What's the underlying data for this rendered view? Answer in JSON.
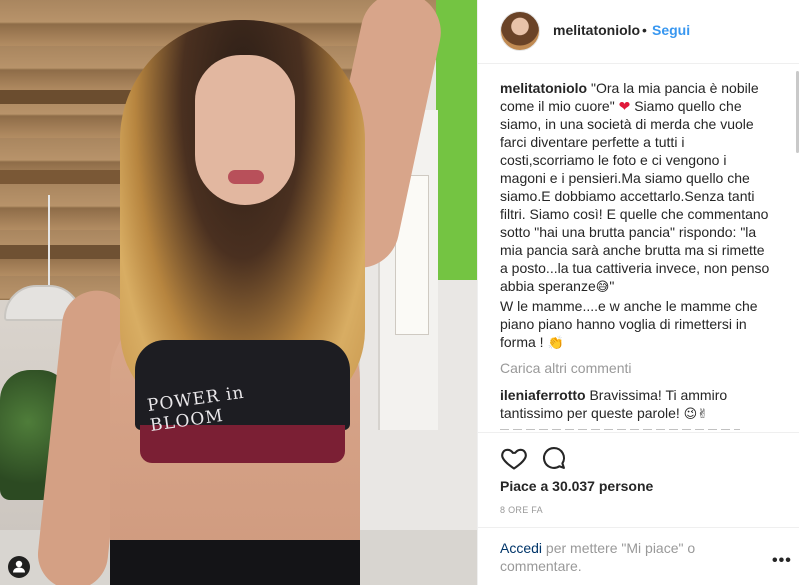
{
  "post": {
    "username": "melitatoniolo",
    "header_separator": "•",
    "follow_label": "Segui"
  },
  "caption": {
    "username": "melitatoniolo",
    "text_part1": "\"Ora la mia pancia è nobile come il mio cuore\"",
    "heart_emoji": "❤",
    "text_part2": "Siamo quello che siamo, in una società di merda che vuole farci diventare perfette a tutti i costi,scorriamo le foto e ci vengono i magoni e i pensieri.Ma siamo quello che siamo.E dobbiamo accettarlo.Senza tanti filtri. Siamo così! E quelle che commentano sotto \"hai una brutta pancia\" rispondo: \"la mia pancia sarà anche brutta ma si rimette a posto...la tua cattiveria invece, non penso abbia speranze",
    "emoji_2": "😅",
    "text_part3": "\"",
    "text_part4": "W le mamme....e w anche le mamme che piano piano hanno voglia di rimettersi in forma !",
    "emoji_3": "👏"
  },
  "load_more_label": "Carica altri commenti",
  "comment": {
    "username": "ileniaferrotto",
    "text": "Bravissima! Ti ammiro tantissimo per queste parole!",
    "emoji": "😉✌"
  },
  "photo": {
    "shirt_text": "POWER in BLOOM",
    "user_tag_icon": "user-icon"
  },
  "icons": {
    "like": "heart-outline-icon",
    "comment": "speech-bubble-icon",
    "more": "more-options-icon"
  },
  "likes_text": "Piace a 30.037 persone",
  "timestamp": "8 ORE FA",
  "footer": {
    "login_label": "Accedi",
    "login_rest": "per mettere \"Mi piace\" o commentare.",
    "more_label": "•••"
  },
  "colors": {
    "link_blue": "#3897f0",
    "heart_red": "#e0193a",
    "login_dark_blue": "#003569",
    "muted_gray": "#999999"
  }
}
